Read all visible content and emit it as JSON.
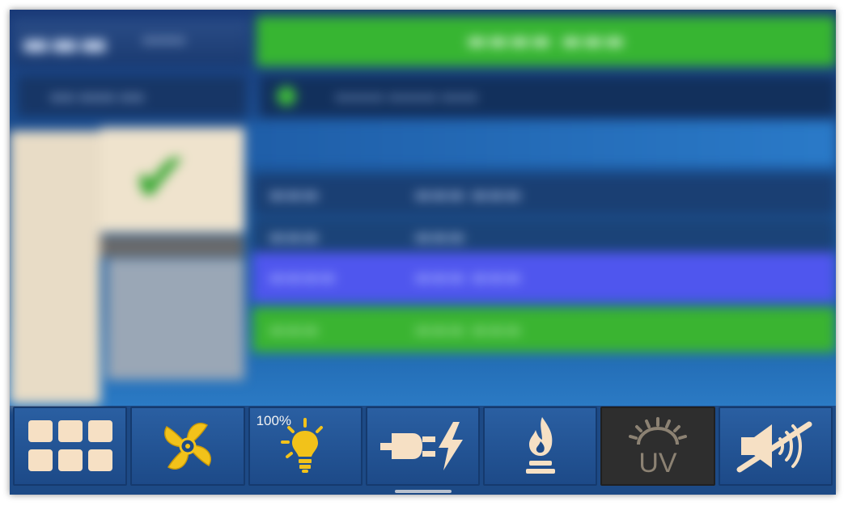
{
  "toolbar": {
    "light_level": "100%",
    "buttons": [
      {
        "id": "menu",
        "icon": "grid-icon"
      },
      {
        "id": "fan",
        "icon": "fan-icon"
      },
      {
        "id": "light",
        "icon": "lightbulb-icon"
      },
      {
        "id": "power-outlet",
        "icon": "plug-icon"
      },
      {
        "id": "gas",
        "icon": "flame-icon"
      },
      {
        "id": "uv",
        "icon": "uv-lamp-icon",
        "label": "UV"
      },
      {
        "id": "mute",
        "icon": "speaker-muted-icon"
      }
    ]
  },
  "colors": {
    "status_ok": "#37b532",
    "info_row": "#4f56ee",
    "toolbar_bg": "#1d4a86",
    "icon_accent": "#f2c21a",
    "icon_light": "#f6e0c4"
  }
}
